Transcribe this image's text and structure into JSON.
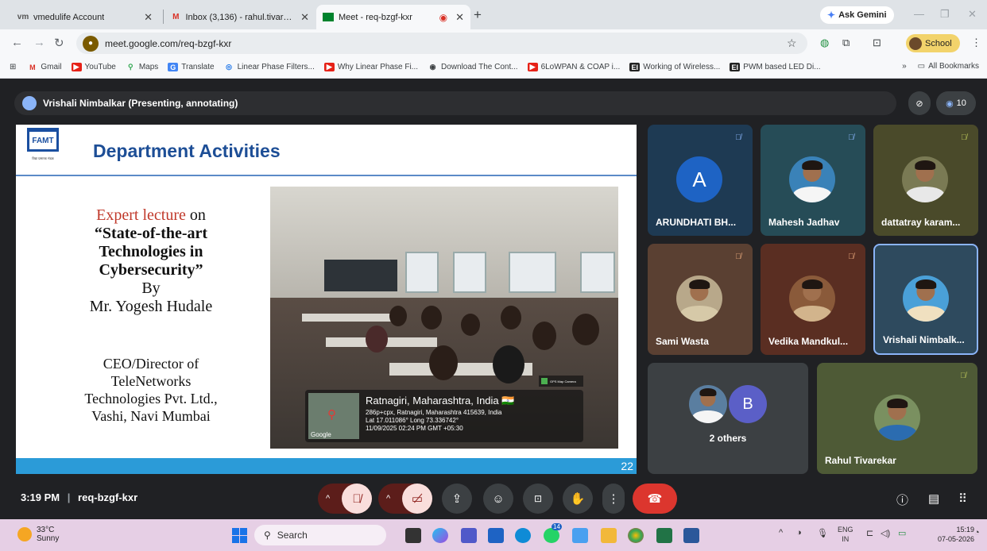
{
  "browser": {
    "tabs": [
      {
        "title": "vmedulife Account",
        "icon": "vmedulife-icon"
      },
      {
        "title": "Inbox (3,136) - rahul.tivarekar@",
        "icon": "gmail-icon"
      },
      {
        "title": "Meet - req-bzgf-kxr",
        "icon": "meet-icon",
        "active": true
      }
    ],
    "ask_gemini": "Ask Gemini",
    "url": "meet.google.com/req-bzgf-kxr",
    "profile_label": "School",
    "bookmarks": [
      {
        "label": "Gmail",
        "icon": "gmail-icon",
        "color": "#d93025"
      },
      {
        "label": "YouTube",
        "icon": "youtube-icon",
        "color": "#e62117"
      },
      {
        "label": "Maps",
        "icon": "maps-icon",
        "color": "#34a853"
      },
      {
        "label": "Translate",
        "icon": "translate-icon",
        "color": "#4285f4"
      },
      {
        "label": "Linear Phase Filters...",
        "icon": "globe-icon",
        "color": "#1a73e8"
      },
      {
        "label": "Why Linear Phase Fi...",
        "icon": "youtube-icon",
        "color": "#e62117"
      },
      {
        "label": "Download The Cont...",
        "icon": "globe-icon",
        "color": "#3c4043"
      },
      {
        "label": "6LoWPAN & COAP i...",
        "icon": "youtube-icon",
        "color": "#e62117"
      },
      {
        "label": "Working of Wireless...",
        "icon": "ei-icon",
        "color": "#222222"
      },
      {
        "label": "PWM based LED Di...",
        "icon": "ei-icon",
        "color": "#222222"
      }
    ],
    "bookmarks_more": "»",
    "all_bookmarks": "All Bookmarks"
  },
  "meet": {
    "presenter_label": "Vrishali Nimbalkar (Presenting, annotating)",
    "participant_count": "10",
    "slide": {
      "logo_text": "FAMT",
      "logo_tagline": "विद्या प्रसारक मंडळ",
      "title": "Department Activities",
      "line1_red": "Expert lecture",
      "line1_rest": " on",
      "line2": "“State-of-the-art",
      "line3": "Technologies in",
      "line4": "Cybersecurity”",
      "line5": "By",
      "line6": "Mr. Yogesh Hudale",
      "line7": "CEO/Director of",
      "line8": "TeleNetworks",
      "line9": "Technologies Pvt. Ltd.,",
      "line10": "Vashi, Navi Mumbai",
      "page_number": "22",
      "photo": {
        "place": "Ratnagiri, Maharashtra, India 🇮🇳",
        "address": "286p+cpx, Ratnagiri, Maharashtra 415639, India",
        "coords": "Lat 17.011086° Long 73.336742°",
        "datetime": "11/09/2025 02:24 PM GMT +05:30",
        "map_label": "Google",
        "badge": "GPS Map Camera"
      }
    },
    "tiles": [
      {
        "name": "ARUNDHATI BH...",
        "initial": "A"
      },
      {
        "name": "Mahesh Jadhav"
      },
      {
        "name": "dattatray karam..."
      },
      {
        "name": "Sami Wasta"
      },
      {
        "name": "Vedika Mandkul..."
      },
      {
        "name": "Vrishali Nimbalk..."
      },
      {
        "name": "2 others",
        "initial": "B"
      },
      {
        "name": "Rahul Tivarekar"
      }
    ],
    "time": "3:19 PM",
    "meeting_code": "req-bzgf-kxr"
  },
  "taskbar": {
    "temp": "33°C",
    "condition": "Sunny",
    "search": "Search",
    "lang1": "ENG",
    "lang2": "IN",
    "time": "15:19",
    "date": "07-05-2026",
    "whatsapp_badge": "14"
  }
}
